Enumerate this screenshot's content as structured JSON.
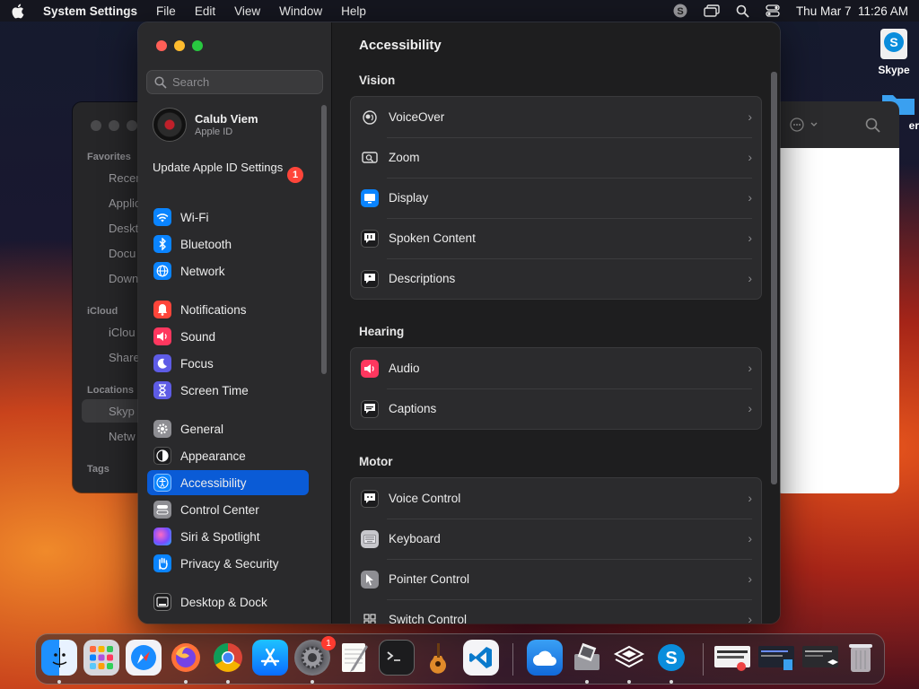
{
  "menubar": {
    "app_name": "System Settings",
    "items": [
      "File",
      "Edit",
      "View",
      "Window",
      "Help"
    ],
    "clock": "Thu Mar 7  11:26 AM"
  },
  "desktop": {
    "skype_label": "Skype",
    "folder_label": "er"
  },
  "finder": {
    "sections": [
      "Favorites",
      "iCloud",
      "Locations",
      "Tags"
    ],
    "items": [
      "Recen",
      "Applic",
      "Deskt",
      "Docu",
      "Down",
      "iClou",
      "Share",
      "Skyp",
      "Netw"
    ]
  },
  "sidebar": {
    "search_placeholder": "Search",
    "account_name": "Calub Viem",
    "account_sub": "Apple ID",
    "update_label": "Update Apple ID Settings",
    "update_badge": "1",
    "items": [
      {
        "label": "Wi-Fi",
        "icon": "wifi-icon",
        "color": "#0a84ff"
      },
      {
        "label": "Bluetooth",
        "icon": "bluetooth-icon",
        "color": "#0a84ff"
      },
      {
        "label": "Network",
        "icon": "globe-icon",
        "color": "#0a84ff"
      },
      {
        "label": "Notifications",
        "icon": "bell-icon",
        "color": "#ff453a"
      },
      {
        "label": "Sound",
        "icon": "speaker-icon",
        "color": "#ff375f"
      },
      {
        "label": "Focus",
        "icon": "moon-icon",
        "color": "#5e5ce6"
      },
      {
        "label": "Screen Time",
        "icon": "hourglass-icon",
        "color": "#5e5ce6"
      },
      {
        "label": "General",
        "icon": "gear-icon",
        "color": "#8e8e93"
      },
      {
        "label": "Appearance",
        "icon": "appearance-icon",
        "color": "#1c1c1e"
      },
      {
        "label": "Accessibility",
        "icon": "accessibility-icon",
        "color": "#0a84ff"
      },
      {
        "label": "Control Center",
        "icon": "control-center-icon",
        "color": "#8e8e93"
      },
      {
        "label": "Siri & Spotlight",
        "icon": "siri-icon",
        "color": "#bf5af2"
      },
      {
        "label": "Privacy & Security",
        "icon": "hand-icon",
        "color": "#0a84ff"
      },
      {
        "label": "Desktop & Dock",
        "icon": "dock-icon",
        "color": "#1c1c1e"
      }
    ]
  },
  "content": {
    "title": "Accessibility",
    "sections": [
      {
        "title": "Vision",
        "rows": [
          {
            "label": "VoiceOver",
            "icon": "voiceover-icon"
          },
          {
            "label": "Zoom",
            "icon": "zoom-icon"
          },
          {
            "label": "Display",
            "icon": "display-icon"
          },
          {
            "label": "Spoken Content",
            "icon": "spoken-content-icon"
          },
          {
            "label": "Descriptions",
            "icon": "descriptions-icon"
          }
        ]
      },
      {
        "title": "Hearing",
        "rows": [
          {
            "label": "Audio",
            "icon": "audio-icon"
          },
          {
            "label": "Captions",
            "icon": "captions-icon"
          }
        ]
      },
      {
        "title": "Motor",
        "rows": [
          {
            "label": "Voice Control",
            "icon": "voice-control-icon"
          },
          {
            "label": "Keyboard",
            "icon": "keyboard-icon"
          },
          {
            "label": "Pointer Control",
            "icon": "pointer-icon"
          },
          {
            "label": "Switch Control",
            "icon": "switch-control-icon"
          }
        ]
      }
    ]
  },
  "dock": {
    "settings_badge": "1",
    "apps": [
      "finder-icon",
      "launchpad-icon",
      "safari-icon",
      "firefox-icon",
      "chrome-icon",
      "app-store-icon",
      "system-settings-icon",
      "textedit-icon",
      "terminal-icon",
      "garageband-icon",
      "vscode-icon",
      "weather-icon",
      "preview-icon",
      "docker-icon",
      "skype-icon"
    ]
  }
}
